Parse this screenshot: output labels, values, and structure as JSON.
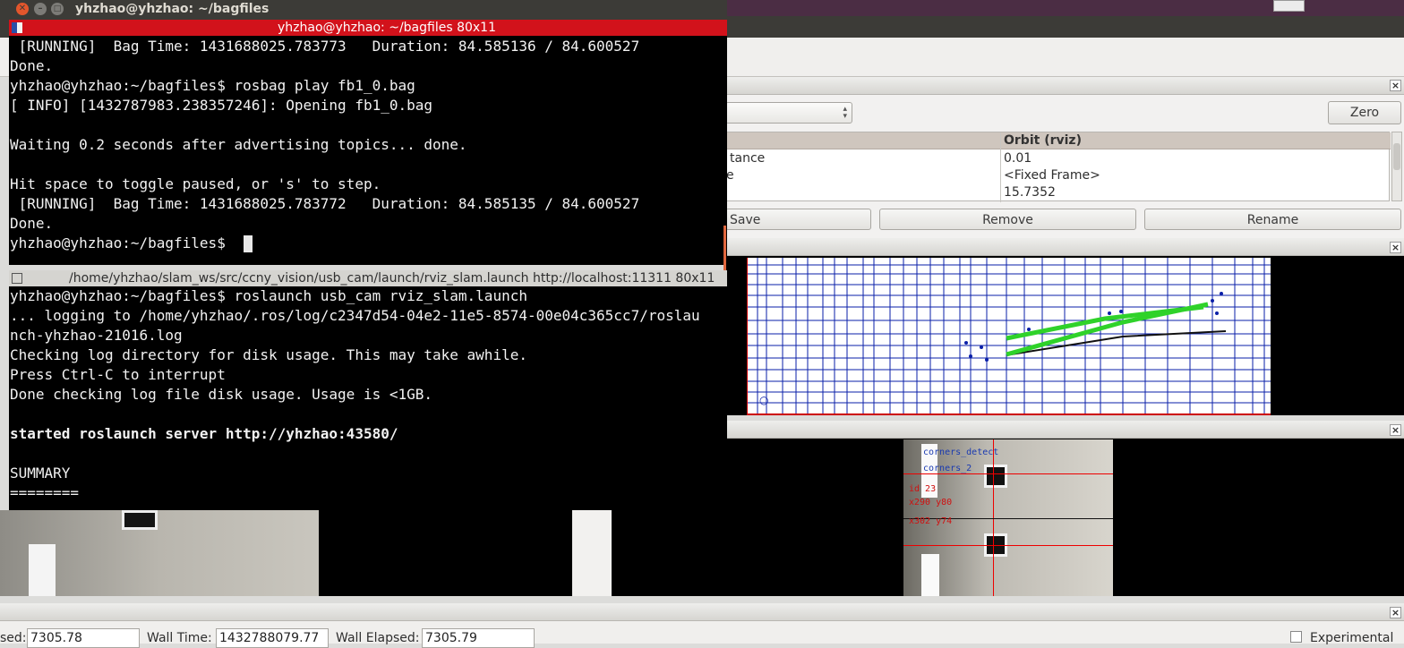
{
  "desktop": {
    "top_bar_color": "#4b2d44"
  },
  "rviz": {
    "views_panel": {
      "zero_label": "Zero",
      "table_header_value": "Orbit (rviz)",
      "rows": [
        {
          "name": "tance",
          "value": "0.01"
        },
        {
          "name": "e",
          "value": "<Fixed Frame>"
        },
        {
          "name": "",
          "value": "15.7352"
        }
      ],
      "buttons": {
        "save": "Save",
        "remove": "Remove",
        "rename": "Rename"
      }
    },
    "time_panel": {
      "elapsed_label": "sed:",
      "elapsed_value": "7305.78",
      "wall_time_label": "Wall Time:",
      "wall_time_value": "1432788079.77",
      "wall_elapsed_label": "Wall Elapsed:",
      "wall_elapsed_value": "7305.79",
      "experimental_label": "Experimental"
    },
    "camera_overlay": {
      "lines": [
        "corners_detect",
        "corners_2",
        "id 23",
        "x290 y80",
        "x302 y74"
      ]
    }
  },
  "terminal1": {
    "window_title": "yhzhao@yhzhao: ~/bagfiles",
    "tab_title": "yhzhao@yhzhao: ~/bagfiles 80x11",
    "lines": [
      " [RUNNING]  Bag Time: 1431688025.783773   Duration: 84.585136 / 84.600527",
      "Done.",
      "yhzhao@yhzhao:~/bagfiles$ rosbag play fb1_0.bag",
      "[ INFO] [1432787983.238357246]: Opening fb1_0.bag",
      "",
      "Waiting 0.2 seconds after advertising topics... done.",
      "",
      "Hit space to toggle paused, or 's' to step.",
      " [RUNNING]  Bag Time: 1431688025.783772   Duration: 84.585135 / 84.600527",
      "Done."
    ],
    "prompt": "yhzhao@yhzhao:~/bagfiles$ "
  },
  "terminal2": {
    "tab_title": "/home/yhzhao/slam_ws/src/ccny_vision/usb_cam/launch/rviz_slam.launch http://localhost:11311 80x11",
    "lines": [
      "yhzhao@yhzhao:~/bagfiles$ roslaunch usb_cam rviz_slam.launch",
      "... logging to /home/yhzhao/.ros/log/c2347d54-04e2-11e5-8574-00e04c365cc7/roslau",
      "nch-yhzhao-21016.log",
      "Checking log directory for disk usage. This may take awhile.",
      "Press Ctrl-C to interrupt",
      "Done checking log file disk usage. Usage is <1GB.",
      ""
    ],
    "bold_line": "started roslaunch server http://yhzhao:43580/",
    "tail_lines": [
      "",
      "SUMMARY",
      "========"
    ]
  },
  "colors": {
    "terminal_bg": "#000000",
    "terminal_tab_active": "#d2121b",
    "green_path": "#2fd22a",
    "grid_blue": "#0a1fa8"
  }
}
